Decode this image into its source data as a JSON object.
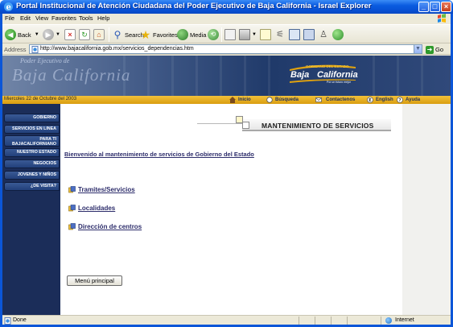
{
  "window": {
    "title": "Portal Institucional de Atención Ciudadana del Poder Ejecutivo de Baja California - Israel Explorer",
    "min": "_",
    "max": "□",
    "close": "×"
  },
  "menubar": {
    "items": [
      "File",
      "Edit",
      "View",
      "Favorites",
      "Tools",
      "Help"
    ]
  },
  "toolbar": {
    "back": "Back",
    "search": "Search",
    "favorites": "Favorites",
    "media": "Media"
  },
  "address": {
    "label": "Address",
    "url": "http://www.bajacalifornia.gob.mx/servicios_dependencias.htm",
    "go": "Go"
  },
  "banner": {
    "small_text": "Poder Ejecutivo de",
    "big_text": "Baja California",
    "logo_top": "GOBIERNO DEL ESTADO",
    "logo_baja": "Baja",
    "logo_california": "California",
    "logo_sub": "Por un futuro mejor"
  },
  "goldbar": {
    "date": "Miercoles 22 de Octubre del 2003",
    "links": [
      "Inicio",
      "Búsqueda",
      "Contactenos",
      "English",
      "Ayuda"
    ]
  },
  "leftnav": {
    "items": [
      "GOBIERNO",
      "SERVICIOS EN LINEA",
      "PARA TI",
      "BAJACALIFORNIANO",
      "NUESTRO ESTADO",
      "NEGOCIOS",
      "JOVENES Y NIÑOS",
      "¿DE VISITA?"
    ]
  },
  "main": {
    "section_title": "MANTENIMIENTO DE SERVICIOS",
    "welcome": "Bienvenido al mantenimiento de servicios de Gobierno del Estado",
    "links": [
      "Tramites/Servicios",
      "Localidades",
      "Dirección de centros"
    ],
    "main_menu_button": "Menú principal"
  },
  "statusbar": {
    "status": "Done",
    "zone": "Internet"
  }
}
